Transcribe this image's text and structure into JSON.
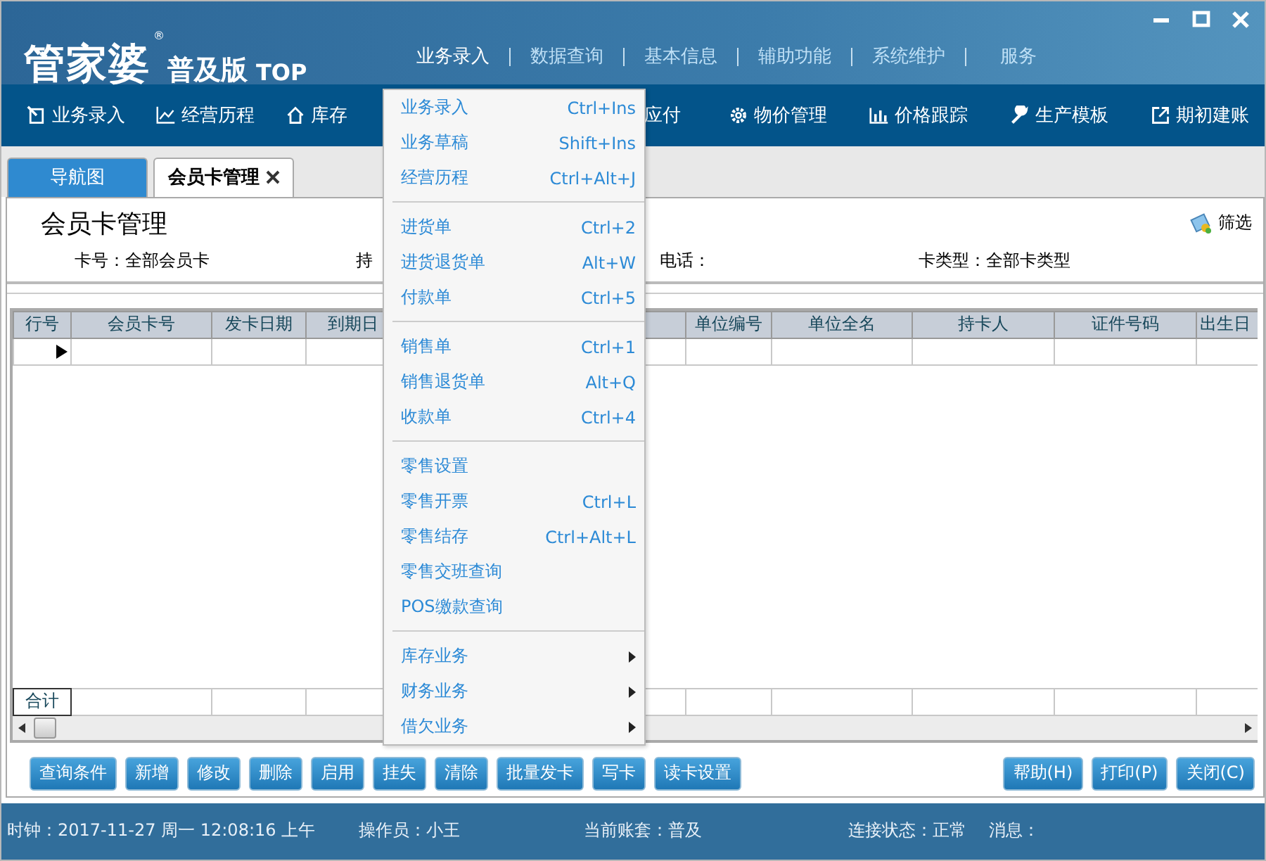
{
  "window": {
    "logo": "管家婆",
    "logo_mark": "®",
    "edition": "普及版",
    "edition_suffix": "TOP"
  },
  "menubar": [
    {
      "label": "业务录入",
      "selected": true
    },
    {
      "label": "数据查询",
      "selected": false
    },
    {
      "label": "基本信息",
      "selected": false
    },
    {
      "label": "辅助功能",
      "selected": false
    },
    {
      "label": "系统维护",
      "selected": false
    },
    {
      "label": "服务",
      "selected": false
    }
  ],
  "toolbar": {
    "left": [
      {
        "label": "业务录入",
        "kind": "entry"
      },
      {
        "label": "经营历程",
        "kind": "chart"
      },
      {
        "label": "库存",
        "kind": "house"
      }
    ],
    "right": [
      {
        "label": "应付",
        "kind": "none"
      },
      {
        "label": "物价管理",
        "kind": "gear"
      },
      {
        "label": "价格跟踪",
        "kind": "bars"
      },
      {
        "label": "生产模板",
        "kind": "wrench"
      },
      {
        "label": "期初建账",
        "kind": "export"
      }
    ]
  },
  "tabs": [
    {
      "label": "导航图",
      "selected": false,
      "closable": false
    },
    {
      "label": "会员卡管理",
      "selected": true,
      "closable": true
    }
  ],
  "page": {
    "title": "会员卡管理",
    "filter_button": "筛选",
    "filters": [
      "卡号：全部会员卡",
      "持",
      "电话：",
      "卡类型：全部卡类型"
    ]
  },
  "table": {
    "columns": [
      "行号",
      "会员卡号",
      "发卡日期",
      "到期日",
      "单位编号",
      "单位全名",
      "持卡人",
      "证件号码",
      "出生日"
    ],
    "rows": [
      {
        "selected": true
      }
    ],
    "footer": "合计"
  },
  "buttons": {
    "left": [
      "查询条件",
      "新增",
      "修改",
      "删除",
      "启用",
      "挂失",
      "清除",
      "批量发卡",
      "写卡",
      "读卡设置"
    ],
    "right": [
      "帮助(H)",
      "打印(P)",
      "关闭(C)"
    ]
  },
  "status_bar": [
    "时钟：2017-11-27 周一 12:08:16 上午",
    "操作员：小王",
    "当前账套：普及",
    "连接状态：正常",
    "消息："
  ],
  "menu": {
    "groups": [
      {
        "items": [
          {
            "label": "业务录入",
            "shortcut": "Ctrl+Ins",
            "kind": "item"
          },
          {
            "label": "业务草稿",
            "shortcut": "Shift+Ins",
            "kind": "item"
          },
          {
            "label": "经营历程",
            "shortcut": "Ctrl+Alt+J",
            "kind": "item"
          }
        ]
      },
      {
        "items": [
          {
            "label": "进货单",
            "shortcut": "Ctrl+2",
            "kind": "item"
          },
          {
            "label": "进货退货单",
            "shortcut": "Alt+W",
            "kind": "item"
          },
          {
            "label": "付款单",
            "shortcut": "Ctrl+5",
            "kind": "item"
          }
        ]
      },
      {
        "items": [
          {
            "label": "销售单",
            "shortcut": "Ctrl+1",
            "kind": "item"
          },
          {
            "label": "销售退货单",
            "shortcut": "Alt+Q",
            "kind": "item"
          },
          {
            "label": "收款单",
            "shortcut": "Ctrl+4",
            "kind": "item"
          }
        ]
      },
      {
        "items": [
          {
            "label": "零售设置",
            "kind": "item"
          },
          {
            "label": "零售开票",
            "shortcut": "Ctrl+L",
            "kind": "item"
          },
          {
            "label": "零售结存",
            "shortcut": "Ctrl+Alt+L",
            "kind": "item"
          },
          {
            "label": "零售交班查询",
            "kind": "item"
          },
          {
            "label": "POS缴款查询",
            "kind": "item"
          }
        ]
      },
      {
        "items": [
          {
            "label": "库存业务",
            "kind": "submenu"
          },
          {
            "label": "财务业务",
            "kind": "submenu"
          },
          {
            "label": "借欠业务",
            "kind": "submenu"
          }
        ]
      }
    ]
  }
}
